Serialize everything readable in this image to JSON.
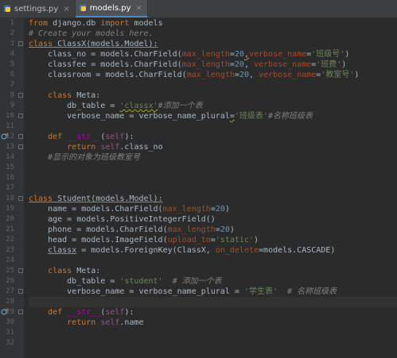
{
  "tabs": [
    {
      "label": "settings.py",
      "active": false,
      "close": "×"
    },
    {
      "label": "models.py",
      "active": true,
      "close": "×"
    }
  ],
  "line_numbers": [
    "1",
    "2",
    "3",
    "4",
    "5",
    "6",
    "7",
    "8",
    "9",
    "10",
    "11",
    "12",
    "13",
    "14",
    "15",
    "16",
    "17",
    "18",
    "19",
    "20",
    "21",
    "22",
    "23",
    "24",
    "25",
    "26",
    "27",
    "28",
    "29",
    "30",
    "31",
    "32"
  ],
  "code": {
    "l1": {
      "kw1": "from",
      "mod": " django.db ",
      "kw2": "import",
      "rest": " models"
    },
    "l2": {
      "comment": "# Create your models here."
    },
    "l3": {
      "kw": "class",
      "sp": " ",
      "name": "ClassX",
      "base": "(models.Model):"
    },
    "l4": {
      "pre": "    class_no = models.CharField(",
      "p1": "max_length",
      "eq1": "=",
      "n1": "20",
      "c1": ",",
      "p2": "verbose_name",
      "eq2": "=",
      "s1": "'班级号'",
      "end": ")"
    },
    "l5": {
      "pre": "    classfee = models.CharField(",
      "p1": "max_length",
      "eq1": "=",
      "n1": "20",
      "c1": ", ",
      "p2": "verbose_name",
      "eq2": "=",
      "s1": "'班费'",
      "end": ")"
    },
    "l6": {
      "pre": "    classroom = models.CharField(",
      "p1": "max_length",
      "eq1": "=",
      "n1": "20",
      "c1": ", ",
      "p2": "verbose_name",
      "eq2": "=",
      "s1": "'教室号'",
      "end": ")"
    },
    "l8": {
      "kw": "    class",
      "rest": " Meta:"
    },
    "l9": {
      "pre": "        db_table = ",
      "s1": "'classx'",
      "cm": "#添加一个表"
    },
    "l10": {
      "pre": "        verbose_name = verbose_name_plural",
      "eq": "=",
      "s1": "'班级表'",
      "cm": "#名称班级表"
    },
    "l12": {
      "kw": "    def",
      "sp": " ",
      "fn": "__str__",
      "p": "(",
      "self": "self",
      "end": "):"
    },
    "l13": {
      "kw": "        return",
      "self": " self",
      "rest": ".class_no"
    },
    "l14": {
      "cm": "    #显示的对象为班级教室号"
    },
    "l18": {
      "kw": "class",
      "sp": " ",
      "name": "Student",
      "base": "(models.Model):"
    },
    "l19": {
      "pre": "    name = models.CharField(",
      "p1": "max_length",
      "eq1": "=",
      "n1": "20",
      "end": ")"
    },
    "l20": {
      "pre": "    age = models.PositiveIntegerField()"
    },
    "l21": {
      "pre": "    phone = models.CharField(",
      "p1": "max_length",
      "eq1": "=",
      "n1": "20",
      "end": ")"
    },
    "l22": {
      "pre": "    head = models.ImageField(",
      "p1": "upload_to",
      "eq1": "=",
      "s1": "'static'",
      "end": ")"
    },
    "l23": {
      "pre1": "    ",
      "u": "classx",
      "pre2": " = models.ForeignKey(ClassX, ",
      "p1": "on_delete",
      "eq1": "=",
      "rest": "models.CASCADE)"
    },
    "l25": {
      "kw": "    class",
      "rest": " Meta:"
    },
    "l26": {
      "pre": "        db_table = ",
      "s1": "'student'",
      "cm": "  # 添加一个表"
    },
    "l27": {
      "pre": "        verbose_name = verbose_name_plural = ",
      "s1": "'学生表'",
      "cm": "  # 名称班级表"
    },
    "l29": {
      "kw": "    def",
      "sp": " ",
      "fn": "__str__",
      "p": "(",
      "self": "self",
      "end": "):"
    },
    "l30": {
      "kw": "        return",
      "self": " self",
      "rest": ".name"
    }
  },
  "colors": {
    "background": "#2b2b2b",
    "gutter": "#313335",
    "keyword": "#cc7832",
    "string": "#6a8759",
    "number": "#6897bb",
    "comment": "#808080",
    "param": "#aa4926"
  }
}
